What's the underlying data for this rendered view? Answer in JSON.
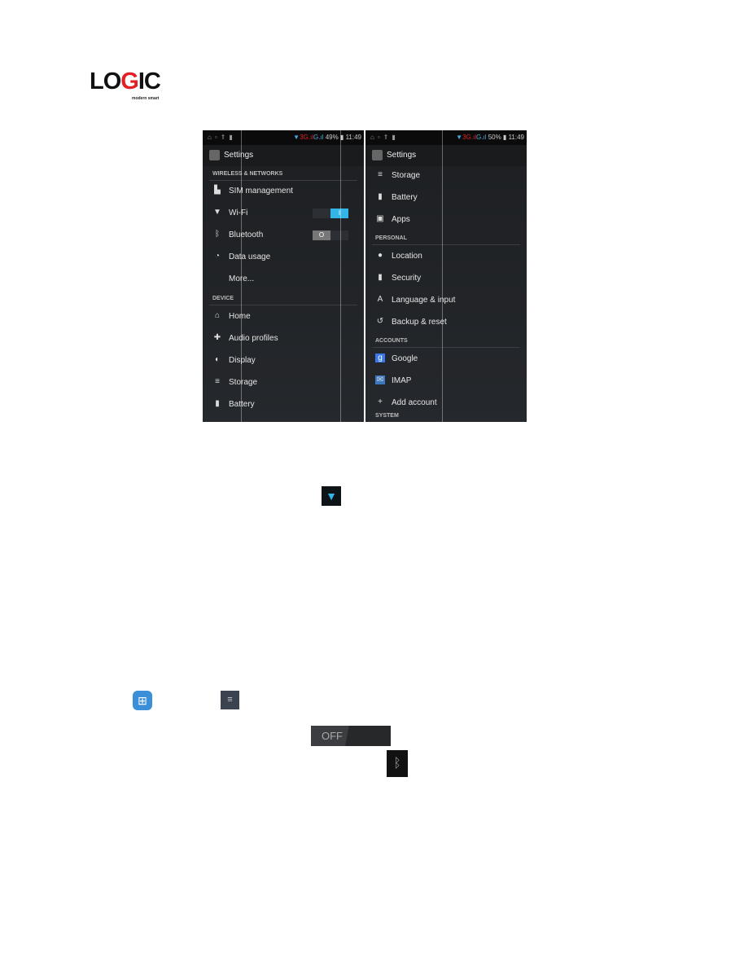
{
  "logo": {
    "text_lo": "LO",
    "text_g": "G",
    "text_ic": "IC",
    "tagline": "modern smart"
  },
  "left": {
    "status": {
      "time": "11:49",
      "battery": "49%",
      "net": "3G",
      "net2": "G"
    },
    "title": "Settings",
    "sections": [
      {
        "header": "WIRELESS & NETWORKS"
      },
      {
        "header": "DEVICE"
      }
    ],
    "items": [
      {
        "icon": "sim-icon",
        "glyph": "▙",
        "label": "SIM management"
      },
      {
        "icon": "wifi-icon",
        "glyph": "▼",
        "label": "Wi-Fi",
        "toggle": "I"
      },
      {
        "icon": "bluetooth-icon",
        "glyph": "ᛒ",
        "label": "Bluetooth",
        "toggle": "O"
      },
      {
        "icon": "data-usage-icon",
        "glyph": "◔",
        "label": "Data usage"
      },
      {
        "icon": "",
        "glyph": "",
        "label": "More..."
      },
      {
        "icon": "home-icon",
        "glyph": "⌂",
        "label": "Home"
      },
      {
        "icon": "audio-profiles-icon",
        "glyph": "✚",
        "label": "Audio profiles"
      },
      {
        "icon": "display-icon",
        "glyph": "◐",
        "label": "Display"
      },
      {
        "icon": "storage-icon",
        "glyph": "≡",
        "label": "Storage"
      },
      {
        "icon": "battery-icon",
        "glyph": "▮",
        "label": "Battery"
      }
    ]
  },
  "right": {
    "status": {
      "time": "11:49",
      "battery": "50%",
      "net": "3G",
      "net2": "G"
    },
    "title": "Settings",
    "sections": [
      {
        "header": "PERSONAL"
      },
      {
        "header": "ACCOUNTS"
      },
      {
        "header": "SYSTEM"
      }
    ],
    "items": [
      {
        "icon": "storage-icon",
        "glyph": "≡",
        "label": "Storage"
      },
      {
        "icon": "battery-icon",
        "glyph": "▮",
        "label": "Battery"
      },
      {
        "icon": "apps-icon",
        "glyph": "▣",
        "label": "Apps"
      },
      {
        "icon": "location-icon",
        "glyph": "●",
        "label": "Location"
      },
      {
        "icon": "security-icon",
        "glyph": "▮",
        "label": "Security"
      },
      {
        "icon": "language-icon",
        "glyph": "A",
        "label": "Language & input"
      },
      {
        "icon": "backup-icon",
        "glyph": "↺",
        "label": "Backup & reset"
      },
      {
        "icon": "google-icon",
        "glyph": "g",
        "label": "Google"
      },
      {
        "icon": "imap-icon",
        "glyph": "✉",
        "label": "IMAP"
      },
      {
        "icon": "add-icon",
        "glyph": "+",
        "label": "Add account"
      }
    ]
  },
  "inline_icons": {
    "off_toggle": "OFF"
  },
  "colors": {
    "accent": "#33b5e5",
    "logo_red": "#e31e24"
  }
}
